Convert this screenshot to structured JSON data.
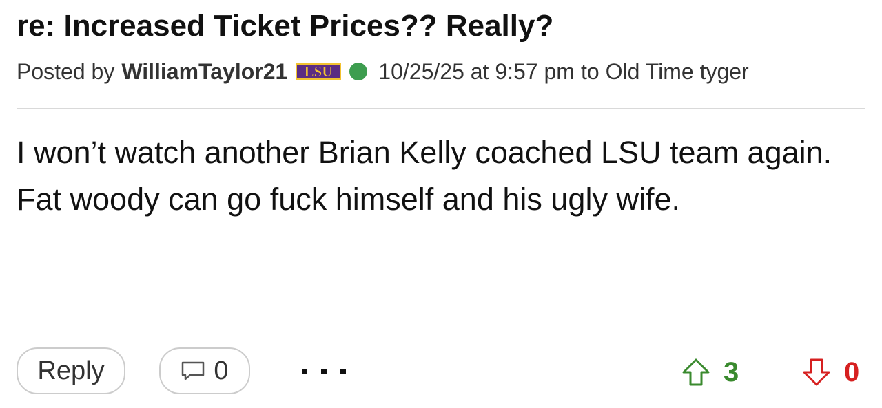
{
  "post": {
    "title": "re: Increased Ticket Prices?? Really?",
    "posted_by_label": "Posted by",
    "author": "WilliamTaylor21",
    "team_logo_text": "LSU",
    "timestamp": "10/25/25 at 9:57 pm",
    "to_label": "to",
    "recipient": "Old Time tyger",
    "body": "I won’t watch another Brian Kelly coached LSU team again. Fat woody can go fuck himself and his ugly wife."
  },
  "actions": {
    "reply_label": "Reply",
    "comment_count": "0",
    "more_icon": "ellipsis-icon",
    "upvote_count": "3",
    "downvote_count": "0"
  },
  "colors": {
    "online": "#3d9d4f",
    "upvote": "#3a8a2e",
    "downvote": "#d62020",
    "logo_purple": "#5b2c83",
    "logo_gold": "#f2c230"
  }
}
